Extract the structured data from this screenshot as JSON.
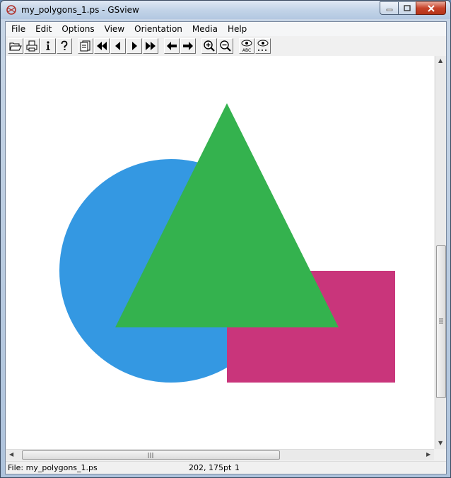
{
  "window": {
    "title": "my_polygons_1.ps - GSview",
    "caption_min": "▬",
    "caption_max": "▢",
    "caption_close": "✕"
  },
  "menu": {
    "items": [
      "File",
      "Edit",
      "Options",
      "View",
      "Orientation",
      "Media",
      "Help"
    ]
  },
  "toolbar": {
    "buttons": [
      {
        "name": "open-icon",
        "glyph": "📂"
      },
      {
        "name": "print-icon",
        "glyph": "🖶"
      },
      {
        "name": "info-icon",
        "glyph": "i"
      },
      {
        "name": "help-icon",
        "glyph": "?"
      },
      {
        "name": "goto-page-icon",
        "glyph": "☞"
      },
      {
        "name": "first-page-icon",
        "glyph": "⏮"
      },
      {
        "name": "prev-page-icon",
        "glyph": "◀"
      },
      {
        "name": "next-page-icon",
        "glyph": "▶"
      },
      {
        "name": "last-page-icon",
        "glyph": "⏭"
      },
      {
        "name": "back-icon",
        "glyph": "←"
      },
      {
        "name": "forward-icon",
        "glyph": "→"
      },
      {
        "name": "zoom-in-icon",
        "glyph": "⊕"
      },
      {
        "name": "zoom-out-icon",
        "glyph": "⊖"
      },
      {
        "name": "text-extract-icon",
        "glyph": "👁"
      },
      {
        "name": "find-icon",
        "glyph": "👁"
      }
    ]
  },
  "document": {
    "shapes": [
      {
        "type": "circle",
        "color": "#3498e2"
      },
      {
        "type": "rectangle",
        "color": "#c9357b"
      },
      {
        "type": "triangle",
        "color": "#34b24e"
      }
    ]
  },
  "scroll": {
    "up_arrow": "▲",
    "down_arrow": "▼",
    "left_arrow": "◀",
    "right_arrow": "▶"
  },
  "status": {
    "file": "File: my_polygons_1.ps",
    "coords": "202, 175pt",
    "page": "1"
  }
}
